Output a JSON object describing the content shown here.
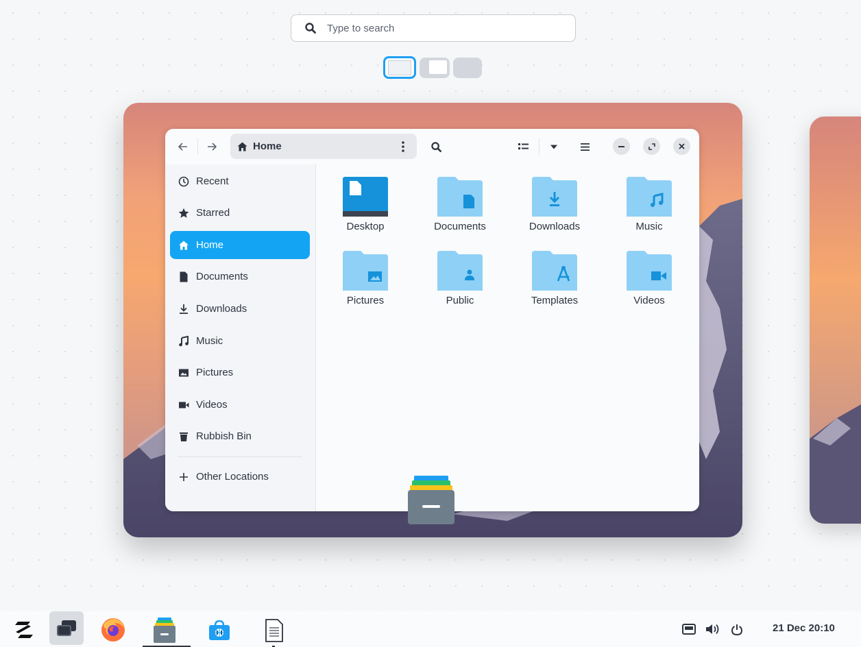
{
  "search": {
    "placeholder": "Type to search"
  },
  "header": {
    "path_label": "Home"
  },
  "sidebar": {
    "items": [
      {
        "label": "Recent",
        "icon": "clock-icon"
      },
      {
        "label": "Starred",
        "icon": "star-icon"
      },
      {
        "label": "Home",
        "icon": "home-icon",
        "active": true
      },
      {
        "label": "Documents",
        "icon": "document-icon"
      },
      {
        "label": "Downloads",
        "icon": "download-icon"
      },
      {
        "label": "Music",
        "icon": "music-icon"
      },
      {
        "label": "Pictures",
        "icon": "picture-icon"
      },
      {
        "label": "Videos",
        "icon": "video-icon"
      },
      {
        "label": "Rubbish Bin",
        "icon": "trash-icon"
      }
    ],
    "other_locations": "Other Locations"
  },
  "files": [
    {
      "label": "Desktop"
    },
    {
      "label": "Documents"
    },
    {
      "label": "Downloads"
    },
    {
      "label": "Music"
    },
    {
      "label": "Pictures"
    },
    {
      "label": "Public"
    },
    {
      "label": "Templates"
    },
    {
      "label": "Videos"
    }
  ],
  "taskbar": {
    "clock": "21 Dec 20:10"
  },
  "colors": {
    "accent": "#13a5f3",
    "folder": "#8fd0f6",
    "folder_dark": "#1592d9"
  }
}
